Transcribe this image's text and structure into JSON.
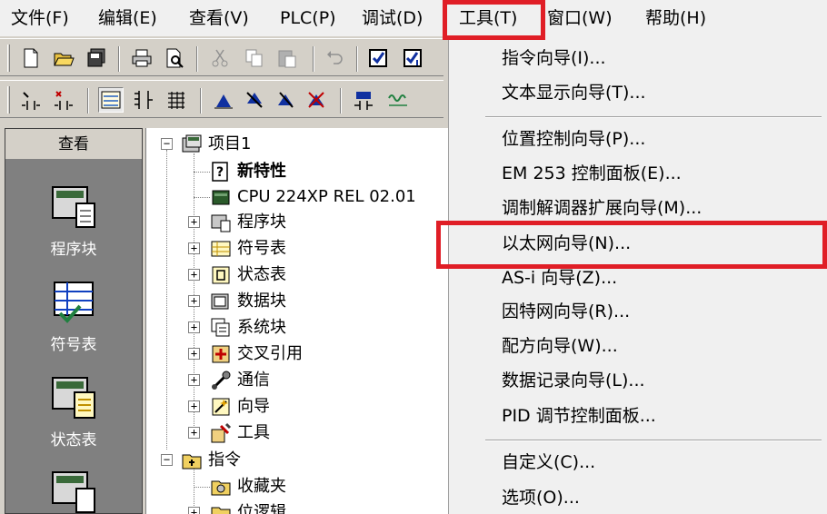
{
  "menubar": {
    "items": [
      "文件(F)",
      "编辑(E)",
      "查看(V)",
      "PLC(P)",
      "调试(D)",
      "工具(T)",
      "窗口(W)",
      "帮助(H)"
    ],
    "active_item": "工具(T)"
  },
  "navigation": {
    "header": "查看",
    "items": [
      {
        "label": "程序块",
        "icon": "program-block-icon"
      },
      {
        "label": "符号表",
        "icon": "symbol-table-icon"
      },
      {
        "label": "状态表",
        "icon": "status-table-icon"
      },
      {
        "label": "",
        "icon": "data-block-icon"
      }
    ]
  },
  "tree": {
    "root": "项目1",
    "nodes": [
      {
        "label": "新特性",
        "icon": "new-features-icon"
      },
      {
        "label": "CPU 224XP REL 02.01",
        "icon": "cpu-icon"
      },
      {
        "label": "程序块",
        "icon": "program-block-icon"
      },
      {
        "label": "符号表",
        "icon": "symbol-table-icon"
      },
      {
        "label": "状态表",
        "icon": "status-table-icon"
      },
      {
        "label": "数据块",
        "icon": "data-block-icon"
      },
      {
        "label": "系统块",
        "icon": "system-block-icon"
      },
      {
        "label": "交叉引用",
        "icon": "cross-reference-icon"
      },
      {
        "label": "通信",
        "icon": "communication-icon"
      },
      {
        "label": "向导",
        "icon": "wizard-icon"
      },
      {
        "label": "工具",
        "icon": "tools-icon"
      }
    ],
    "instructions": {
      "label": "指令",
      "children": [
        {
          "label": "收藏夹",
          "icon": "favorites-icon"
        },
        {
          "label": "位逻辑",
          "icon": "bit-logic-icon"
        }
      ]
    }
  },
  "tools_menu": {
    "groups": [
      [
        "指令向导(I)...",
        "文本显示向导(T)..."
      ],
      [
        "位置控制向导(P)...",
        "EM 253 控制面板(E)...",
        "调制解调器扩展向导(M)...",
        "以太网向导(N)...",
        "AS-i 向导(Z)...",
        "因特网向导(R)...",
        "配方向导(W)...",
        "数据记录向导(L)...",
        "PID 调节控制面板..."
      ],
      [
        "自定义(C)...",
        "选项(O)..."
      ]
    ],
    "highlighted_item": "以太网向导(N)..."
  },
  "colors": {
    "highlight_box": "#e01e26",
    "nav_background": "#808080",
    "menu_background": "#f0f0f0"
  }
}
